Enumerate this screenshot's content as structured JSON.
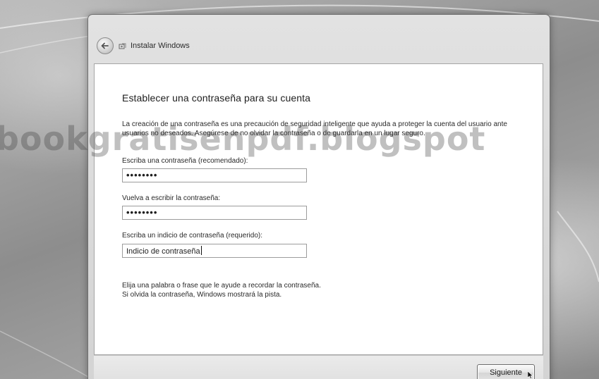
{
  "window": {
    "title": "Instalar Windows",
    "back_icon": "back-arrow-icon",
    "setup_icon": "windows-setup-icon"
  },
  "page": {
    "heading": "Establecer una contraseña para su cuenta",
    "intro": "La creación de una contraseña es una precaución de seguridad inteligente que ayuda a proteger la cuenta del usuario ante usuarios no deseados. Asegúrese de no olvidar la contraseña o de guardarla en un lugar seguro.",
    "password": {
      "label": "Escriba una contraseña (recomendado):",
      "value": "••••••••"
    },
    "confirm_password": {
      "label": "Vuelva a escribir la contraseña:",
      "value": "••••••••"
    },
    "hint": {
      "label": "Escriba un indicio de contraseña (requerido):",
      "value": "Indicio de contraseña"
    },
    "help_line1": "Elija una palabra o frase que le ayude a recordar la contraseña.",
    "help_line2": "Si olvida la contraseña, Windows mostrará la pista."
  },
  "footer": {
    "next_label": "Siguiente"
  },
  "watermark": "bookgratisenpdf.blogspot",
  "colors": {
    "content_background": "#ffffff",
    "frame": "#d8d8d8",
    "text": "#2a2a2a"
  }
}
